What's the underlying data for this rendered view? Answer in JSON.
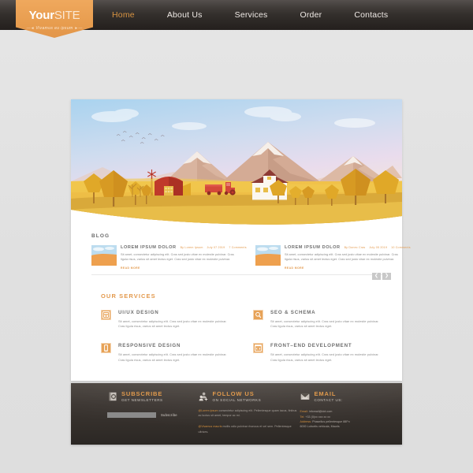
{
  "header": {
    "logo": {
      "name_bold": "Your",
      "name_light": "SITE",
      "tagline": "Vivamus eu ipsum"
    },
    "nav": [
      {
        "label": "Home",
        "active": true
      },
      {
        "label": "About Us",
        "active": false
      },
      {
        "label": "Services",
        "active": false
      },
      {
        "label": "Order",
        "active": false
      },
      {
        "label": "Contacts",
        "active": false
      }
    ]
  },
  "hero": {
    "alt": "flat design autumn countryside landscape with mountains, barn, windmill, tractor, house and trees"
  },
  "blog": {
    "section_title": "BLOG",
    "posts": [
      {
        "title": "LOREM IPSUM DOLOR",
        "author": "By Lorem Ipsum",
        "date": "July 07 2019",
        "comments": "7 Comments",
        "text": "Sit amet, consectetur adipiscing elit. Cras sed justo vitae ex molestie pulvinar. Cras ligula risus, varius sit amet lectus eget. Cras sed justo vitae ex molestie pulvinar.",
        "read_more": "READ MORE"
      },
      {
        "title": "LOREM IPSUM DOLOR",
        "author": "By Donec Cras",
        "date": "July 05 2019",
        "comments": "10 Comments",
        "text": "Sit amet, consectetur adipiscing elit. Cras sed justo vitae ex molestie pulvinar. Cras ligula risus, varius sit amet lectus eget. Cras sed justo vitae ex molestie pulvinar.",
        "read_more": "READ MORE"
      }
    ],
    "prev_label": "❮",
    "next_label": "❯"
  },
  "services": {
    "section_title": "OUR SERVICES",
    "items": [
      {
        "title": "UI/UX  DESIGN",
        "icon": "layout-icon",
        "text": "Sit amet, consectetur adipiscing elit. Cras sed justo vitae ex molestie pulvinar. Cras ligula risus, varius sit amet lectus eget."
      },
      {
        "title": "SEO & SCHEMA",
        "icon": "magnifier-icon",
        "text": "Sit amet, consectetur adipiscing elit. Cras sed justo vitae ex molestie pulvinar. Cras ligula risus, varius sit amet lectus eget."
      },
      {
        "title": "RESPONSIVE  DESIGN",
        "icon": "mobile-icon",
        "text": "Sit amet, consectetur adipiscing elit. Cras sed justo vitae ex molestie pulvinar. Cras ligula risus, varius sit amet lectus eget."
      },
      {
        "title": "FRONT–END  DEVELOPMENT",
        "icon": "code-window-icon",
        "text": "Sit amet, consectetur adipiscing elit. Cras sed justo vitae ex molestie pulvinar. Cras ligula risus, varius sit amet lectus eget."
      }
    ]
  },
  "footer": {
    "subscribe": {
      "icon": "newsletter-icon",
      "title": "SUBSCRIBE",
      "subtitle": "GET NEWSLETTERS",
      "input_placeholder": "",
      "input_value": "",
      "button_label": "Subscribe"
    },
    "follow": {
      "icon": "users-icon",
      "title": "FOLLOW US",
      "subtitle": "ON SOCIAL NETWORKS",
      "tweets": [
        {
          "handle": "@Lorem ipsum",
          "text": " consectetur adipiscing elit. Pellentesque quam iacus, finibus ac luctus sit amet, tempor ac mi."
        },
        {
          "handle": "@Vivamus mauris",
          "text": " mollis odio pulvinar rhoncus et vel sem. Pellentesque ultrices."
        }
      ]
    },
    "email": {
      "icon": "envelope-icon",
      "title": "EMAIL",
      "subtitle": "CONTACT US:",
      "lines": [
        {
          "key": "Email:",
          "value": " infomail@dot.com"
        },
        {
          "key": "Tel:",
          "value": " +33 (0)xx xxx xx xx"
        },
        {
          "key": "Address:",
          "value": " Phasellus pellentesque 88Fn"
        },
        {
          "key": "",
          "value": "6000 Lobortis vehicula, Mauris"
        }
      ]
    }
  },
  "colors": {
    "accent": "#e39a4e",
    "dark": "#332e2a",
    "page_bg": "#e3e3e3",
    "card_bg": "#ffffff"
  }
}
